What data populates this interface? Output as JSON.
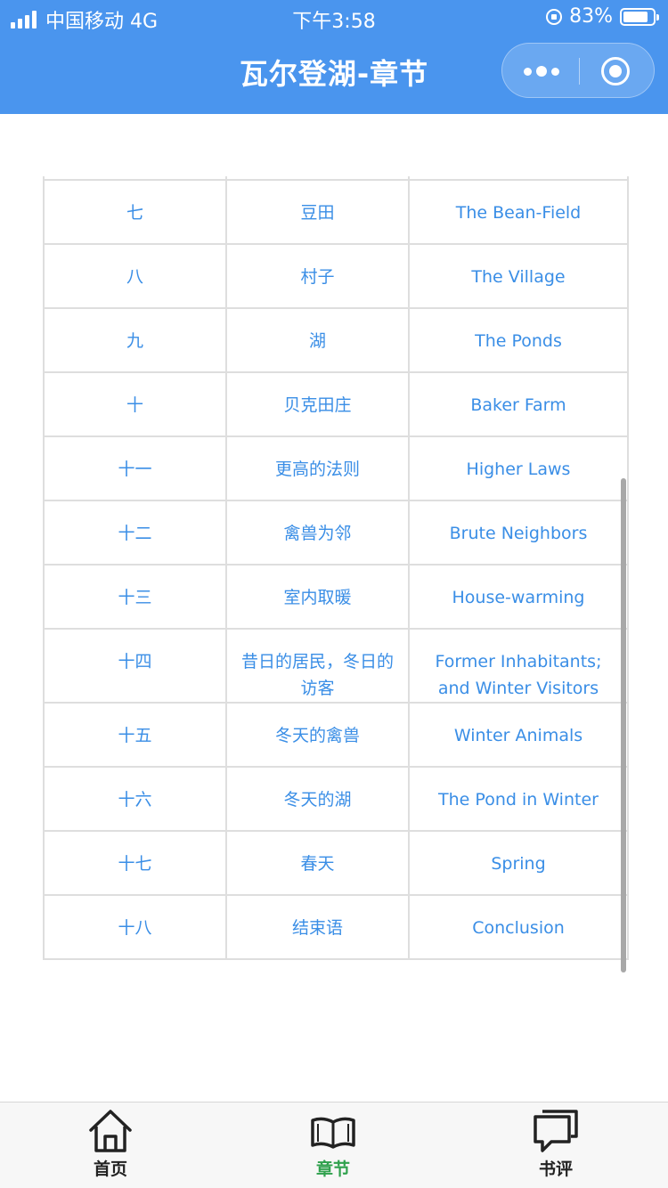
{
  "status": {
    "carrier": "中国移动 4G",
    "time": "下午3:58",
    "battery": "83%",
    "battery_level": 0.83
  },
  "header": {
    "title": "瓦尔登湖-章节"
  },
  "chapters": [
    {
      "num": "七",
      "cn": "豆田",
      "en": "The Bean-Field"
    },
    {
      "num": "八",
      "cn": "村子",
      "en": "The Village"
    },
    {
      "num": "九",
      "cn": "湖",
      "en": "The Ponds"
    },
    {
      "num": "十",
      "cn": "贝克田庄",
      "en": "Baker Farm"
    },
    {
      "num": "十一",
      "cn": "更高的法则",
      "en": "Higher Laws"
    },
    {
      "num": "十二",
      "cn": "禽兽为邻",
      "en": "Brute Neighbors"
    },
    {
      "num": "十三",
      "cn": "室内取暖",
      "en": "House-warming"
    },
    {
      "num": "十四",
      "cn": "昔日的居民，冬日的访客",
      "en": "Former Inhabitants; and Winter Visitors"
    },
    {
      "num": "十五",
      "cn": "冬天的禽兽",
      "en": "Winter Animals"
    },
    {
      "num": "十六",
      "cn": "冬天的湖",
      "en": "The Pond in Winter"
    },
    {
      "num": "十七",
      "cn": "春天",
      "en": "Spring"
    },
    {
      "num": "十八",
      "cn": "结束语",
      "en": "Conclusion"
    }
  ],
  "tabbar": {
    "items": [
      {
        "label": "首页",
        "icon": "home-icon",
        "active": false
      },
      {
        "label": "章节",
        "icon": "book-icon",
        "active": true
      },
      {
        "label": "书评",
        "icon": "comment-icon",
        "active": false
      }
    ],
    "active_color": "#2fa14d"
  },
  "colors": {
    "header_bg": "#4a95ee",
    "link_text": "#3a8ee6"
  }
}
